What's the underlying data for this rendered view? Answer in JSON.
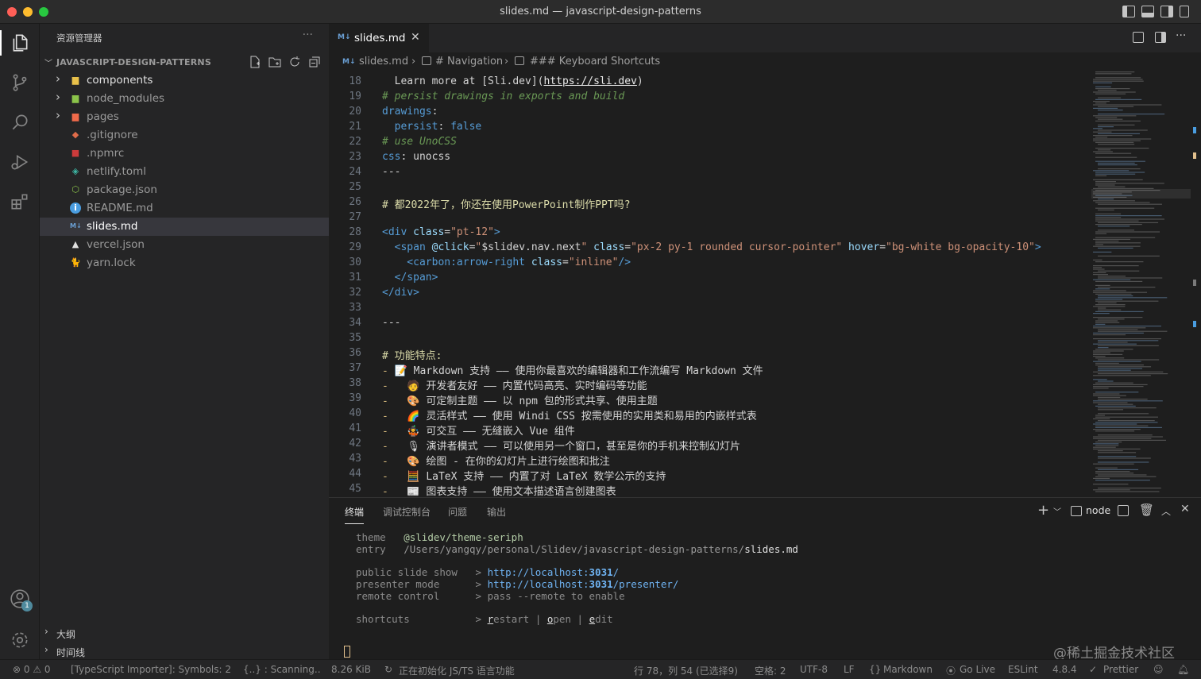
{
  "window": {
    "title": "slides.md — javascript-design-patterns"
  },
  "sidebar": {
    "header": "资源管理器",
    "more": "···",
    "project": "JAVASCRIPT-DESIGN-PATTERNS",
    "items": [
      {
        "name": "components",
        "icon": "folder-icon",
        "color": "#e8c04a",
        "folder": true
      },
      {
        "name": "node_modules",
        "icon": "folder-icon",
        "color": "#8bc34a",
        "folder": true
      },
      {
        "name": "pages",
        "icon": "folder-icon",
        "color": "#f06a4a",
        "folder": true
      },
      {
        "name": ".gitignore",
        "icon": "git-icon",
        "color": "#e06c4a",
        "folder": false
      },
      {
        "name": ".npmrc",
        "icon": "npm-icon",
        "color": "#cc3b3b",
        "folder": false
      },
      {
        "name": "netlify.toml",
        "icon": "netlify-icon",
        "color": "#3db8a5",
        "folder": false
      },
      {
        "name": "package.json",
        "icon": "nodejs-icon",
        "color": "#8bc34a",
        "folder": false
      },
      {
        "name": "README.md",
        "icon": "info-icon",
        "color": "#4a9de0",
        "folder": false
      },
      {
        "name": "slides.md",
        "icon": "markdown-icon",
        "color": "#6a9fd4",
        "folder": false
      },
      {
        "name": "vercel.json",
        "icon": "vercel-icon",
        "color": "#e0e0e0",
        "folder": false
      },
      {
        "name": "yarn.lock",
        "icon": "yarn-icon",
        "color": "#4a8fd4",
        "folder": false
      }
    ],
    "outline": "大纲",
    "timeline": "时间线",
    "account_badge": "1"
  },
  "tabs": {
    "active": "slides.md",
    "md_badge": "M↓",
    "close": "✕"
  },
  "breadcrumb": {
    "file": "slides.md",
    "section": "# Navigation",
    "sub": "### Keyboard Shortcuts"
  },
  "editor": {
    "lines": [
      {
        "n": "18",
        "parts": [
          [
            "plain",
            "  Learn more at [Sli.dev]("
          ],
          [
            "lnk",
            "https://sli.dev"
          ],
          [
            "plain",
            ")"
          ]
        ]
      },
      {
        "n": "19",
        "parts": [
          [
            "cmt",
            "# persist drawings in exports and build"
          ]
        ]
      },
      {
        "n": "20",
        "parts": [
          [
            "key",
            "drawings"
          ],
          [
            "plain",
            ":"
          ]
        ]
      },
      {
        "n": "21",
        "parts": [
          [
            "key",
            "  persist"
          ],
          [
            "plain",
            ": "
          ],
          [
            "key",
            "false"
          ]
        ]
      },
      {
        "n": "22",
        "parts": [
          [
            "cmt",
            "# use UnoCSS"
          ]
        ]
      },
      {
        "n": "23",
        "parts": [
          [
            "key",
            "css"
          ],
          [
            "plain",
            ": unocss"
          ]
        ]
      },
      {
        "n": "24",
        "parts": [
          [
            "plain",
            "---"
          ]
        ]
      },
      {
        "n": "25",
        "parts": []
      },
      {
        "n": "26",
        "parts": [
          [
            "head",
            "# 都2022年了，你还在使用PowerPoint制作PPT吗?"
          ]
        ]
      },
      {
        "n": "27",
        "parts": []
      },
      {
        "n": "28",
        "parts": [
          [
            "tag",
            "<div"
          ],
          [
            "attr",
            " class"
          ],
          [
            "plain",
            "="
          ],
          [
            "str",
            "\"pt-12\""
          ],
          [
            "tag",
            ">"
          ]
        ]
      },
      {
        "n": "29",
        "parts": [
          [
            "tag",
            "  <span"
          ],
          [
            "attr",
            " @click"
          ],
          [
            "plain",
            "="
          ],
          [
            "str",
            "\""
          ],
          [
            "plain",
            "$slidev.nav.next"
          ],
          [
            "str",
            "\""
          ],
          [
            "attr",
            " class"
          ],
          [
            "plain",
            "="
          ],
          [
            "str",
            "\"px-2 py-1 rounded cursor-pointer\""
          ],
          [
            "attr",
            " hover"
          ],
          [
            "plain",
            "="
          ],
          [
            "str",
            "\"bg-white bg-opacity-10\""
          ],
          [
            "tag",
            ">"
          ]
        ]
      },
      {
        "n": "30",
        "parts": [
          [
            "tag",
            "    <carbon:arrow-right"
          ],
          [
            "attr",
            " class"
          ],
          [
            "plain",
            "="
          ],
          [
            "str",
            "\"inline\""
          ],
          [
            "tag",
            "/>"
          ]
        ]
      },
      {
        "n": "31",
        "parts": [
          [
            "tag",
            "  </span>"
          ]
        ]
      },
      {
        "n": "32",
        "parts": [
          [
            "tag",
            "</div>"
          ]
        ]
      },
      {
        "n": "33",
        "parts": []
      },
      {
        "n": "34",
        "parts": [
          [
            "plain",
            "---"
          ]
        ]
      },
      {
        "n": "35",
        "parts": []
      },
      {
        "n": "36",
        "parts": [
          [
            "head",
            "# 功能特点:"
          ]
        ]
      },
      {
        "n": "37",
        "parts": [
          [
            "kw",
            "- "
          ],
          [
            "plain",
            "📝 Markdown 支持 —— 使用你最喜欢的编辑器和工作流编写 Markdown 文件"
          ]
        ]
      },
      {
        "n": "38",
        "parts": [
          [
            "kw",
            "-   "
          ],
          [
            "plain",
            "🧑 开发者友好 —— 内置代码高亮、实时编码等功能"
          ]
        ]
      },
      {
        "n": "39",
        "parts": [
          [
            "kw",
            "-   "
          ],
          [
            "plain",
            "🎨 可定制主题 —— 以 npm 包的形式共享、使用主题"
          ]
        ]
      },
      {
        "n": "40",
        "parts": [
          [
            "kw",
            "-   "
          ],
          [
            "plain",
            "🌈 灵活样式 —— 使用 Windi CSS 按需使用的实用类和易用的内嵌样式表"
          ]
        ]
      },
      {
        "n": "41",
        "parts": [
          [
            "kw",
            "-   "
          ],
          [
            "plain",
            "🤹 可交互 —— 无缝嵌入 Vue 组件"
          ]
        ]
      },
      {
        "n": "42",
        "parts": [
          [
            "kw",
            "-   "
          ],
          [
            "plain",
            "🎙 演讲者模式 —— 可以使用另一个窗口，甚至是你的手机来控制幻灯片"
          ]
        ]
      },
      {
        "n": "43",
        "parts": [
          [
            "kw",
            "-   "
          ],
          [
            "plain",
            "🎨 绘图 - 在你的幻灯片上进行绘图和批注"
          ]
        ]
      },
      {
        "n": "44",
        "parts": [
          [
            "kw",
            "-   "
          ],
          [
            "plain",
            "🧮 LaTeX 支持 —— 内置了对 LaTeX 数学公示的支持"
          ]
        ]
      },
      {
        "n": "45",
        "parts": [
          [
            "kw",
            "-   "
          ],
          [
            "plain",
            "📰 图表支持 —— 使用文本描述语言创建图表"
          ]
        ]
      }
    ]
  },
  "panel": {
    "tabs": [
      "终端",
      "调试控制台",
      "问题",
      "输出"
    ],
    "node_label": "node",
    "terminal": {
      "theme_label": "theme",
      "theme_value": "@slidev/theme-seriph",
      "entry_label": "entry",
      "entry_path": "/Users/yangqy/personal/Slidev/javascript-design-patterns/",
      "entry_file": "slides.md",
      "public_label": "public slide show",
      "public_url_a": "http://localhost:",
      "public_port": "3031",
      "public_url_b": "/",
      "presenter_label": "presenter mode",
      "presenter_url_a": "http://localhost:",
      "presenter_port": "3031",
      "presenter_url_b": "/presenter/",
      "remote_label": "remote control",
      "remote_value": "pass --remote to enable",
      "shortcuts_label": "shortcuts",
      "s_restart_r": "r",
      "s_restart": "estart",
      "s_open_o": "o",
      "s_open": "pen",
      "s_edit_e": "e",
      "s_edit": "dit",
      "sep": "|",
      "arrow": ">"
    }
  },
  "status": {
    "errors": "0",
    "warnings": "0",
    "importer": "[TypeScript Importer]: Symbols: 2",
    "scanning": "{..} : Scanning..",
    "size": "8.26 KiB",
    "init": "正在初始化 JS/TS 语言功能",
    "position": "行 78，列 54 (已选择9)",
    "spaces": "空格: 2",
    "encoding": "UTF-8",
    "eol": "LF",
    "language": "Markdown",
    "golive": "Go Live",
    "eslint": "ESLint",
    "version": "4.8.4",
    "prettier": "Prettier"
  },
  "watermark": "@稀土掘金技术社区",
  "colors": {
    "accent": "#007acc",
    "editor_bg": "#1e1e1e",
    "sidebar_bg": "#252526"
  }
}
